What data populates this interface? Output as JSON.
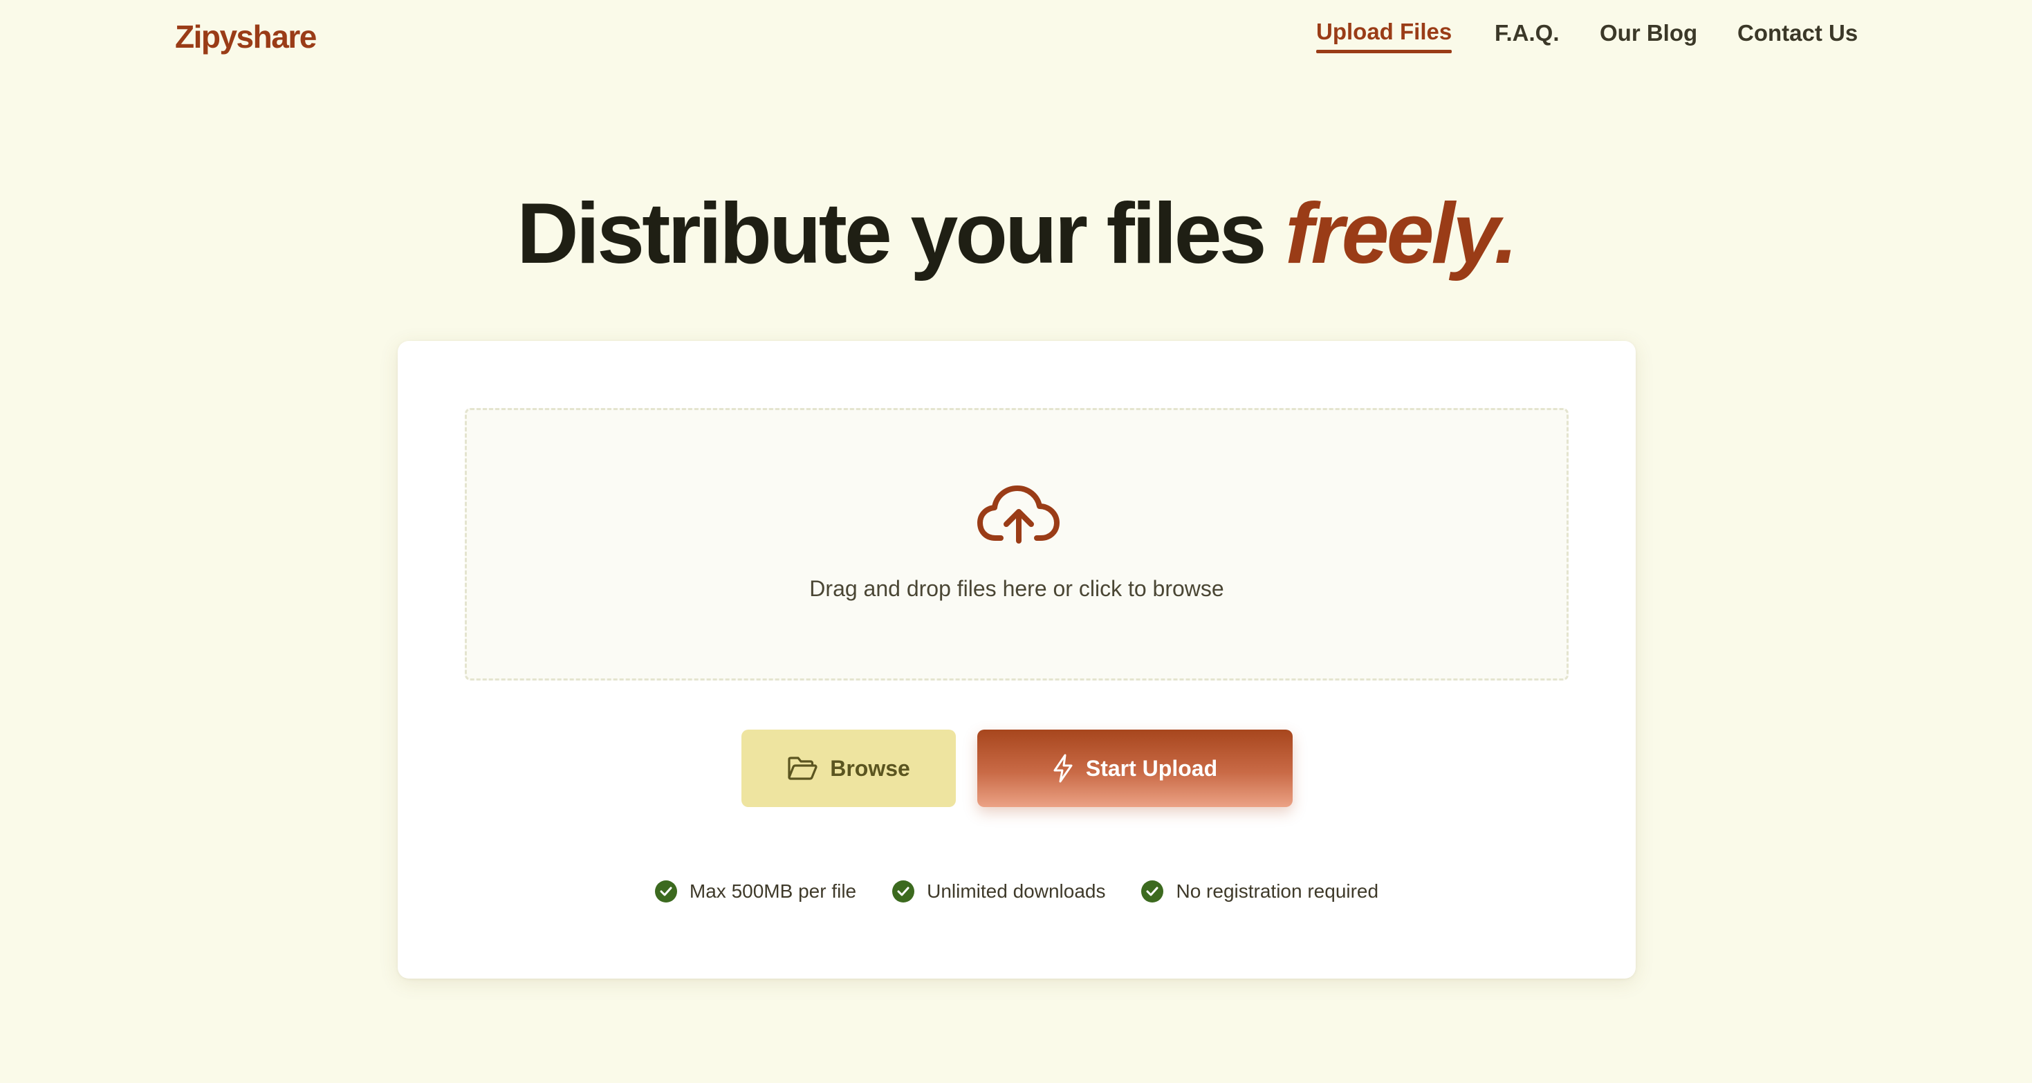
{
  "header": {
    "logo": "Zipyshare",
    "nav": [
      {
        "label": "Upload Files",
        "active": true
      },
      {
        "label": "F.A.Q.",
        "active": false
      },
      {
        "label": "Our Blog",
        "active": false
      },
      {
        "label": "Contact Us",
        "active": false
      }
    ]
  },
  "hero": {
    "title_main": "Distribute your files",
    "title_emphasis": "freely."
  },
  "upload": {
    "dropzone_icon": "cloud-upload-icon",
    "dropzone_text": "Drag and drop files here or click to browse",
    "browse_label": "Browse",
    "browse_icon": "folder-open-icon",
    "start_label": "Start Upload",
    "start_icon": "lightning-icon"
  },
  "features": [
    {
      "label": "Max 500MB per file",
      "icon": "check-circle-icon"
    },
    {
      "label": "Unlimited downloads",
      "icon": "check-circle-icon"
    },
    {
      "label": "No registration required",
      "icon": "check-circle-icon"
    }
  ],
  "colors": {
    "background": "#fafae9",
    "accent": "#9a3c17",
    "browse_button": "#eee4a0",
    "check": "#3c6a1f"
  }
}
